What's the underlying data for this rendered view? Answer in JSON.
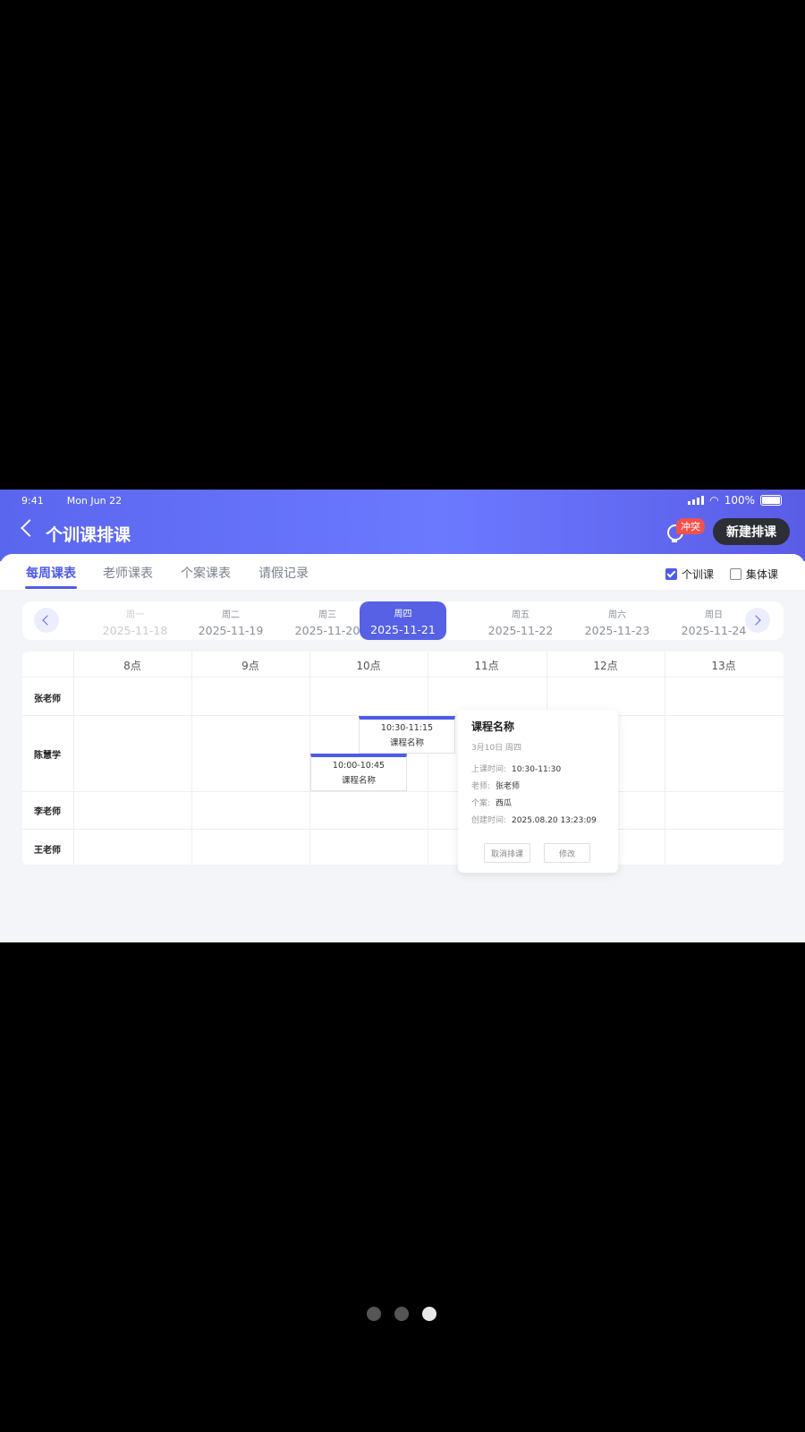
{
  "status_bar": {
    "time": "9:41",
    "date": "Mon Jun 22",
    "battery": "100%"
  },
  "header": {
    "title": "个训课排课",
    "conflict_badge": "冲突",
    "new_button": "新建排课"
  },
  "tabs": [
    "每周课表",
    "老师课表",
    "个案课表",
    "请假记录"
  ],
  "filters": [
    {
      "label": "个训课",
      "checked": true
    },
    {
      "label": "集体课",
      "checked": false
    }
  ],
  "days": [
    {
      "weekday": "周一",
      "date": "2025-11-18"
    },
    {
      "weekday": "周二",
      "date": "2025-11-19"
    },
    {
      "weekday": "周三",
      "date": "2025-11-20"
    },
    {
      "weekday": "周四",
      "date": "2025-11-21"
    },
    {
      "weekday": "周五",
      "date": "2025-11-22"
    },
    {
      "weekday": "周六",
      "date": "2025-11-23"
    },
    {
      "weekday": "周日",
      "date": "2025-11-24"
    }
  ],
  "hours": [
    "8点",
    "9点",
    "10点",
    "11点",
    "12点",
    "13点"
  ],
  "rows": [
    "张老师",
    "陈慧学",
    "李老师",
    "王老师"
  ],
  "events": [
    {
      "time": "10:30-11:15",
      "name": "课程名称"
    },
    {
      "time": "10:00-10:45",
      "name": "课程名称"
    }
  ],
  "popup": {
    "title": "课程名称",
    "subtitle": "3月10日 周四",
    "fields": [
      {
        "label": "上课时间:",
        "value": "10:30-11:30"
      },
      {
        "label": "老师:",
        "value": "张老师"
      },
      {
        "label": "个案:",
        "value": "西瓜"
      },
      {
        "label": "创建时间:",
        "value": "2025.08.20 13:23:09"
      }
    ],
    "cancel_button": "取消排课",
    "edit_button": "修改"
  },
  "pager": {
    "count": 3,
    "active": 3
  }
}
